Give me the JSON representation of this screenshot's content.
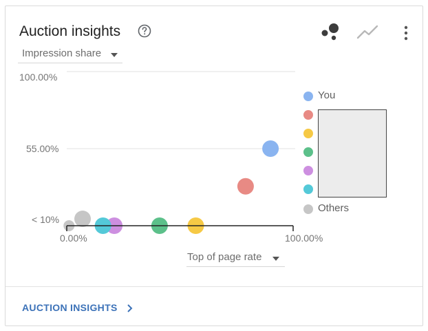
{
  "card": {
    "title": "Auction insights",
    "help_icon": "help-circle-icon",
    "toolbar_icons": [
      "scatter-chart-icon",
      "line-chart-icon",
      "more-vert-icon"
    ],
    "metric_selector": "Impression share",
    "x_selector": "Top of page rate",
    "footer_link": "AUCTION INSIGHTS",
    "footer_chevron": "chevron-right-icon"
  },
  "colors": {
    "you": "#8ab4f0",
    "competitor_red": "#e88a84",
    "competitor_yellow": "#f6c945",
    "competitor_green": "#5cc08a",
    "competitor_purple": "#cd8fe0",
    "competitor_teal": "#54c9d8",
    "others": "#c6c6c6",
    "link": "#3c72b8"
  },
  "chart_data": {
    "type": "scatter",
    "xlabel": "Top of page rate",
    "ylabel": "Impression share",
    "x_tick_labels": [
      "0.00%",
      "100.00%"
    ],
    "y_tick_labels": [
      "100.00%",
      "55.00%",
      "< 10%"
    ],
    "y_ticks": [
      100,
      55,
      10
    ],
    "xlim": [
      0,
      100
    ],
    "ylim": [
      10,
      100
    ],
    "legend_placement": "right",
    "series": [
      {
        "name": "You",
        "color_key": "you",
        "points": [
          {
            "x": 90,
            "y": 55
          }
        ]
      },
      {
        "name": "",
        "color_key": "competitor_red",
        "points": [
          {
            "x": 79,
            "y": 33
          }
        ]
      },
      {
        "name": "",
        "color_key": "competitor_yellow",
        "points": [
          {
            "x": 57,
            "y": 10
          }
        ]
      },
      {
        "name": "",
        "color_key": "competitor_green",
        "points": [
          {
            "x": 41,
            "y": 10
          }
        ]
      },
      {
        "name": "",
        "color_key": "competitor_purple",
        "points": [
          {
            "x": 21,
            "y": 10
          }
        ]
      },
      {
        "name": "",
        "color_key": "competitor_teal",
        "points": [
          {
            "x": 16,
            "y": 10
          }
        ]
      },
      {
        "name": "Others",
        "color_key": "others",
        "points": [
          {
            "x": 7,
            "y": 14
          },
          {
            "x": 1,
            "y": 10
          }
        ]
      }
    ]
  }
}
